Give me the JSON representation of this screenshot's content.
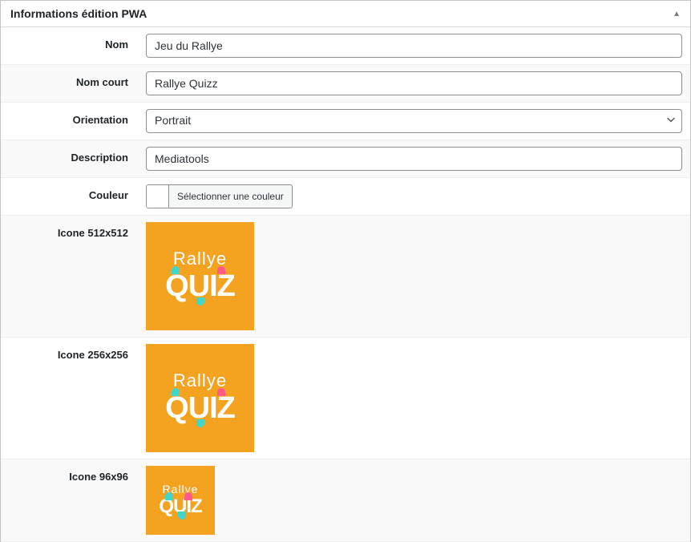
{
  "panel": {
    "title": "Informations édition PWA",
    "collapse_icon": "▲"
  },
  "fields": {
    "name": {
      "label": "Nom",
      "value": "Jeu du Rallye"
    },
    "short_name": {
      "label": "Nom court",
      "value": "Rallye Quizz"
    },
    "orientation": {
      "label": "Orientation",
      "value": "Portrait"
    },
    "description": {
      "label": "Description",
      "value": "Mediatools"
    },
    "color": {
      "label": "Couleur",
      "button_text": "Sélectionner une couleur"
    },
    "icon_512": {
      "label": "Icone 512x512"
    },
    "icon_256": {
      "label": "Icone 256x256"
    },
    "icon_96": {
      "label": "Icone 96x96"
    }
  },
  "icon_content": {
    "line1": "Rallye",
    "line2": "QUIZ"
  }
}
